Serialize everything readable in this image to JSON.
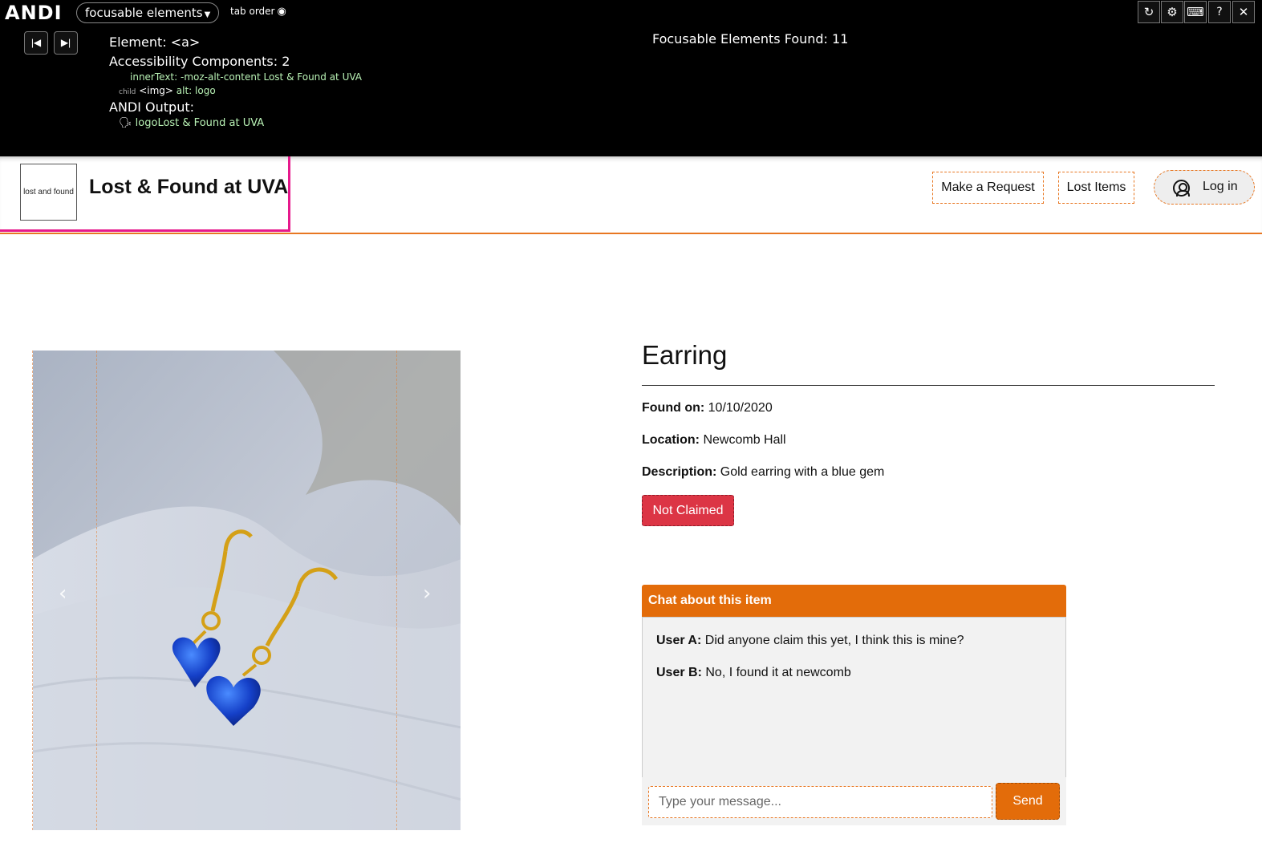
{
  "andi": {
    "logo": "ANDI",
    "module": "focusable elements",
    "tab_order": "tab order",
    "element_label": "Element: <a>",
    "components_label": "Accessibility Components: 2",
    "innertext_label": "innerText:",
    "innertext_value": "-moz-alt-content Lost & Found at UVA",
    "child_label": "child",
    "child_tag": "<img>",
    "child_alt_label": "alt:",
    "child_alt_value": "logo",
    "output_heading": "ANDI Output:",
    "output_alt": "logo",
    "output_text": "Lost & Found at UVA",
    "found": "Focusable Elements Found: 11",
    "help": "?"
  },
  "header": {
    "logo_text": "lost and found",
    "title": "Lost & Found at UVA",
    "nav": [
      "Make a Request",
      "Lost Items"
    ],
    "login": "Log in"
  },
  "item": {
    "title": "Earring",
    "found_label": "Found on:",
    "found_value": "10/10/2020",
    "location_label": "Location:",
    "location_value": "Newcomb Hall",
    "description_label": "Description:",
    "description_value": "Gold earring with a blue gem",
    "status": "Not Claimed"
  },
  "chat": {
    "title": "Chat about this item",
    "messages": [
      {
        "user": "User A:",
        "text": "Did anyone claim this yet, I think this is mine?"
      },
      {
        "user": "User B:",
        "text": "No, I found it at newcomb"
      }
    ],
    "placeholder": "Type your message...",
    "send": "Send"
  },
  "colors": {
    "andi_bg": "#000000",
    "accent_orange": "#e36c0a",
    "focus_pink": "#e6198c",
    "status_red": "#dc3545",
    "andi_green": "#b9f2b5"
  },
  "icons": [
    "prev-element-icon",
    "next-element-icon",
    "refresh-icon",
    "gear-icon",
    "keyboard-icon",
    "help-icon",
    "close-icon",
    "eye-icon",
    "screen-reader-icon",
    "user-circle-icon",
    "chevron-left-icon",
    "chevron-right-icon"
  ]
}
